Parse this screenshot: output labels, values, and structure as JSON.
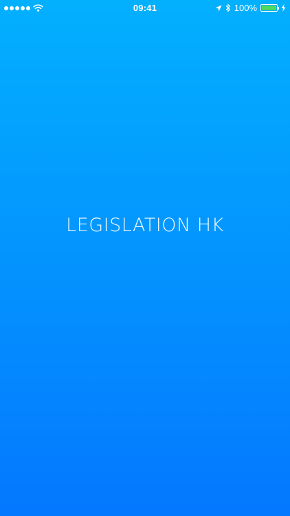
{
  "status_bar": {
    "time": "09:41",
    "battery_percent_label": "100%",
    "battery_level": 1.0,
    "signal_bars": 5,
    "icons": [
      "wifi-icon",
      "location-icon",
      "bluetooth-icon",
      "battery-icon",
      "charging-icon"
    ]
  },
  "splash": {
    "title": "LEGISLATION HK"
  },
  "colors": {
    "background_top": "#03b0fe",
    "background_bottom": "#0478ff",
    "text": "#ffffff",
    "battery_fill": "#4cd964"
  }
}
